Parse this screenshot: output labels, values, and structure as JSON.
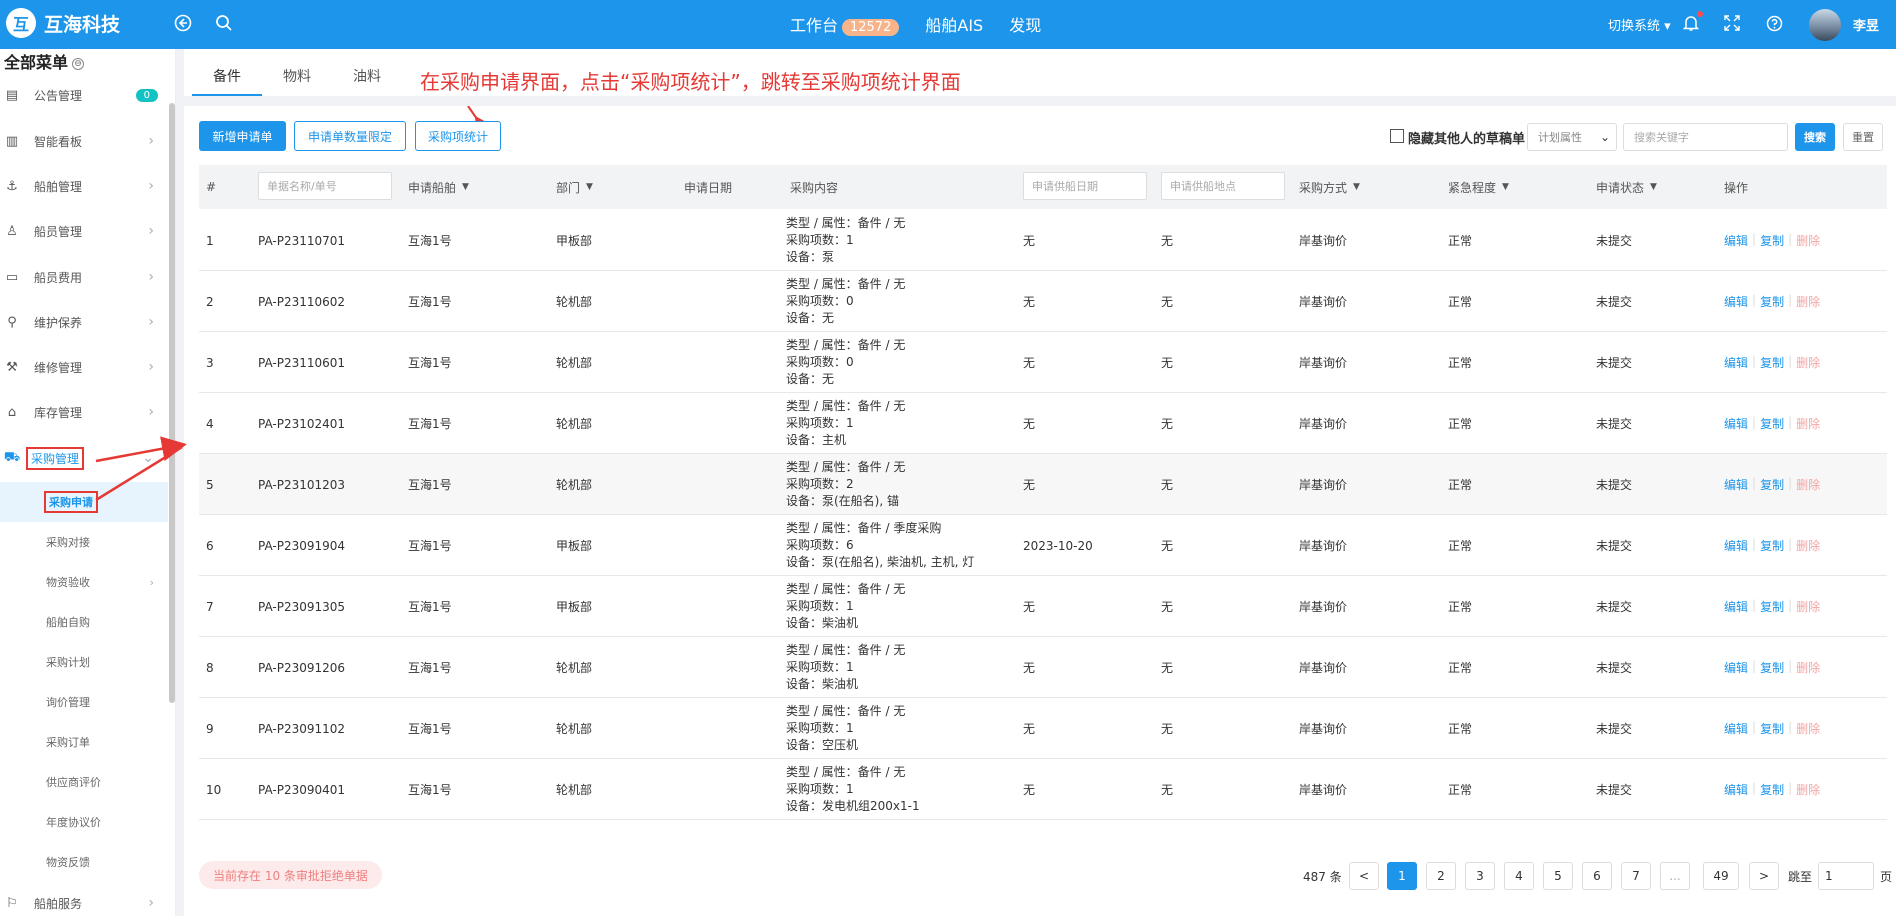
{
  "app": {
    "logo_mark": "互",
    "name": "互海科技"
  },
  "topbar": {
    "back_icon": "back-circle-icon",
    "search_icon": "search-icon",
    "workbench_label": "工作台",
    "workbench_count": "12572",
    "nav_ais": "船舶AIS",
    "nav_discover": "发现",
    "switch_system": "切换系统",
    "username": "李昱"
  },
  "sidebar": {
    "title": "全部菜单",
    "title_icon": "⊖",
    "items": [
      {
        "label": "公告管理",
        "icon": "▤",
        "badge": "0"
      },
      {
        "label": "智能看板",
        "icon": "▥"
      },
      {
        "label": "船舶管理",
        "icon": "⚓"
      },
      {
        "label": "船员管理",
        "icon": "♙"
      },
      {
        "label": "船员费用",
        "icon": "▭"
      },
      {
        "label": "维护保养",
        "icon": "⚲"
      },
      {
        "label": "维修管理",
        "icon": "⚒"
      },
      {
        "label": "库存管理",
        "icon": "⌂"
      },
      {
        "label": "采购管理",
        "icon": "⛟"
      }
    ],
    "sub_items": [
      {
        "label": "采购申请"
      },
      {
        "label": "采购对接"
      },
      {
        "label": "物资验收"
      },
      {
        "label": "船舶自购"
      },
      {
        "label": "采购计划"
      },
      {
        "label": "询价管理"
      },
      {
        "label": "采购订单"
      },
      {
        "label": "供应商评价"
      },
      {
        "label": "年度协议价"
      },
      {
        "label": "物资反馈"
      }
    ],
    "bottom_item": {
      "label": "船舶服务",
      "icon": "⚐"
    }
  },
  "tabs": [
    {
      "label": "备件"
    },
    {
      "label": "物料"
    },
    {
      "label": "油料"
    }
  ],
  "annotation": "在采购申请界面，点击“采购项统计”，跳转至采购项统计界面",
  "toolbar": {
    "new_request": "新增申请单",
    "limit": "申请单数量限定",
    "stats": "采购项统计",
    "hide_others_drafts": "隐藏其他人的草稿单",
    "plan_attr": "计划属性",
    "keyword_placeholder": "搜索关键字",
    "search": "搜索",
    "reset": "重置"
  },
  "table": {
    "headers": {
      "index": "#",
      "doc_placeholder": "单据名称/单号",
      "vessel": "申请船舶",
      "dept": "部门",
      "date": "申请日期",
      "content": "采购内容",
      "supply_date_placeholder": "申请供船日期",
      "supply_place_placeholder": "申请供船地点",
      "method": "采购方式",
      "urgency": "紧急程度",
      "status": "申请状态",
      "ops": "操作"
    },
    "rows": [
      {
        "idx": "1",
        "no": "PA-P23110701",
        "vessel": "互海1号",
        "dept": "甲板部",
        "date": "",
        "c1": "类型 / 属性：备件 / 无",
        "c2": "采购项数：1",
        "c3": "设备：泵",
        "supply_date": "无",
        "supply_place": "无",
        "method": "岸基询价",
        "urgency": "正常",
        "status": "未提交",
        "edit": "编辑",
        "copy": "复制",
        "del": "删除"
      },
      {
        "idx": "2",
        "no": "PA-P23110602",
        "vessel": "互海1号",
        "dept": "轮机部",
        "date": "",
        "c1": "类型 / 属性：备件 / 无",
        "c2": "采购项数：0",
        "c3": "设备：无",
        "supply_date": "无",
        "supply_place": "无",
        "method": "岸基询价",
        "urgency": "正常",
        "status": "未提交",
        "edit": "编辑",
        "copy": "复制",
        "del": "删除"
      },
      {
        "idx": "3",
        "no": "PA-P23110601",
        "vessel": "互海1号",
        "dept": "轮机部",
        "date": "",
        "c1": "类型 / 属性：备件 / 无",
        "c2": "采购项数：0",
        "c3": "设备：无",
        "supply_date": "无",
        "supply_place": "无",
        "method": "岸基询价",
        "urgency": "正常",
        "status": "未提交",
        "edit": "编辑",
        "copy": "复制",
        "del": "删除"
      },
      {
        "idx": "4",
        "no": "PA-P23102401",
        "vessel": "互海1号",
        "dept": "轮机部",
        "date": "",
        "c1": "类型 / 属性：备件 / 无",
        "c2": "采购项数：1",
        "c3": "设备：主机",
        "supply_date": "无",
        "supply_place": "无",
        "method": "岸基询价",
        "urgency": "正常",
        "status": "未提交",
        "edit": "编辑",
        "copy": "复制",
        "del": "删除"
      },
      {
        "idx": "5",
        "no": "PA-P23101203",
        "vessel": "互海1号",
        "dept": "轮机部",
        "date": "",
        "c1": "类型 / 属性：备件 / 无",
        "c2": "采购项数：2",
        "c3": "设备：泵(在船名), 锚",
        "supply_date": "无",
        "supply_place": "无",
        "method": "岸基询价",
        "urgency": "正常",
        "status": "未提交",
        "edit": "编辑",
        "copy": "复制",
        "del": "删除"
      },
      {
        "idx": "6",
        "no": "PA-P23091904",
        "vessel": "互海1号",
        "dept": "甲板部",
        "date": "",
        "c1": "类型 / 属性：备件 / 季度采购",
        "c2": "采购项数：6",
        "c3": "设备：泵(在船名), 柴油机, 主机, 灯",
        "supply_date": "2023-10-20",
        "supply_place": "无",
        "method": "岸基询价",
        "urgency": "正常",
        "status": "未提交",
        "edit": "编辑",
        "copy": "复制",
        "del": "删除"
      },
      {
        "idx": "7",
        "no": "PA-P23091305",
        "vessel": "互海1号",
        "dept": "甲板部",
        "date": "",
        "c1": "类型 / 属性：备件 / 无",
        "c2": "采购项数：1",
        "c3": "设备：柴油机",
        "supply_date": "无",
        "supply_place": "无",
        "method": "岸基询价",
        "urgency": "正常",
        "status": "未提交",
        "edit": "编辑",
        "copy": "复制",
        "del": "删除"
      },
      {
        "idx": "8",
        "no": "PA-P23091206",
        "vessel": "互海1号",
        "dept": "轮机部",
        "date": "",
        "c1": "类型 / 属性：备件 / 无",
        "c2": "采购项数：1",
        "c3": "设备：柴油机",
        "supply_date": "无",
        "supply_place": "无",
        "method": "岸基询价",
        "urgency": "正常",
        "status": "未提交",
        "edit": "编辑",
        "copy": "复制",
        "del": "删除"
      },
      {
        "idx": "9",
        "no": "PA-P23091102",
        "vessel": "互海1号",
        "dept": "轮机部",
        "date": "",
        "c1": "类型 / 属性：备件 / 无",
        "c2": "采购项数：1",
        "c3": "设备：空压机",
        "supply_date": "无",
        "supply_place": "无",
        "method": "岸基询价",
        "urgency": "正常",
        "status": "未提交",
        "edit": "编辑",
        "copy": "复制",
        "del": "删除"
      },
      {
        "idx": "10",
        "no": "PA-P23090401",
        "vessel": "互海1号",
        "dept": "轮机部",
        "date": "",
        "c1": "类型 / 属性：备件 / 无",
        "c2": "采购项数：1",
        "c3": "设备：发电机组200x1-1",
        "supply_date": "无",
        "supply_place": "无",
        "method": "岸基询价",
        "urgency": "正常",
        "status": "未提交",
        "edit": "编辑",
        "copy": "复制",
        "del": "删除"
      }
    ]
  },
  "footer": {
    "warning": "当前存在 10 条审批拒绝单据",
    "total": "487 条",
    "prev": "<",
    "pages": [
      "1",
      "2",
      "3",
      "4",
      "5",
      "6",
      "7",
      "...",
      "49"
    ],
    "next": ">",
    "jump_label": "跳至",
    "jump_value": "1",
    "page_suffix": "页"
  },
  "colors": {
    "primary": "#1c95ea",
    "annotation": "#e53935"
  }
}
